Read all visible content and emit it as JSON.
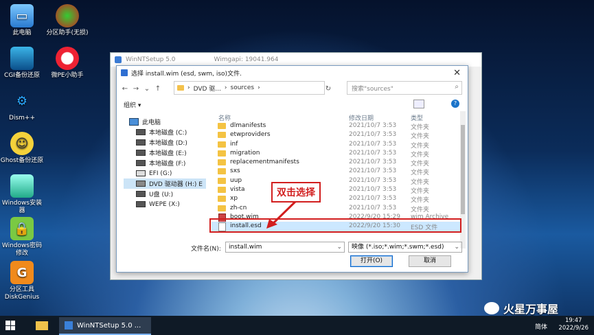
{
  "desktop_icons": [
    {
      "label": "此电脑",
      "icon": "computer-icon"
    },
    {
      "label": "分区助手(无损)",
      "icon": "partition-assistant-icon"
    },
    {
      "label": "CGI备份还原",
      "icon": "cgi-backup-icon"
    },
    {
      "label": "微PE小助手",
      "icon": "pe-helper-icon"
    },
    {
      "label": "Dism++",
      "icon": "dism-icon"
    },
    {
      "label": "Ghost备份还原",
      "icon": "ghost-icon"
    },
    {
      "label": "Windows安装器",
      "icon": "windows-installer-icon"
    },
    {
      "label": "Windows密码修改",
      "icon": "password-lock-icon"
    },
    {
      "label": "分区工具DiskGenius",
      "icon": "diskgenius-icon"
    }
  ],
  "bg_window": {
    "title": "WinNTSetup 5.0",
    "wimgapi": "Wimgapi: 19041.964"
  },
  "dialog": {
    "title": "选择 install.wim (esd, swm, iso)文件.",
    "path": [
      "DVD 驱...",
      "sources"
    ],
    "search_placeholder": "搜索\"sources\"",
    "organize": "组织 ▾",
    "nav": [
      {
        "label": "此电脑",
        "sel": false
      },
      {
        "label": "本地磁盘 (C:)",
        "sel": false
      },
      {
        "label": "本地磁盘 (D:)",
        "sel": false
      },
      {
        "label": "本地磁盘 (E:)",
        "sel": false
      },
      {
        "label": "本地磁盘 (F:)",
        "sel": false
      },
      {
        "label": "EFI (G:)",
        "sel": false
      },
      {
        "label": "DVD 驱动器 (H:) E",
        "sel": true
      },
      {
        "label": "U盘 (U:)",
        "sel": false
      },
      {
        "label": "WEPE (X:)",
        "sel": false
      }
    ],
    "columns": {
      "name": "名称",
      "date": "修改日期",
      "type": "类型"
    },
    "files": [
      {
        "name": "dlmanifests",
        "date": "2021/10/7 3:53",
        "type": "文件夹",
        "kind": "folder"
      },
      {
        "name": "etwproviders",
        "date": "2021/10/7 3:53",
        "type": "文件夹",
        "kind": "folder"
      },
      {
        "name": "inf",
        "date": "2021/10/7 3:53",
        "type": "文件夹",
        "kind": "folder"
      },
      {
        "name": "migration",
        "date": "2021/10/7 3:53",
        "type": "文件夹",
        "kind": "folder"
      },
      {
        "name": "replacementmanifests",
        "date": "2021/10/7 3:53",
        "type": "文件夹",
        "kind": "folder"
      },
      {
        "name": "sxs",
        "date": "2021/10/7 3:53",
        "type": "文件夹",
        "kind": "folder"
      },
      {
        "name": "uup",
        "date": "2021/10/7 3:53",
        "type": "文件夹",
        "kind": "folder"
      },
      {
        "name": "vista",
        "date": "2021/10/7 3:53",
        "type": "文件夹",
        "kind": "folder"
      },
      {
        "name": "xp",
        "date": "2021/10/7 3:53",
        "type": "文件夹",
        "kind": "folder"
      },
      {
        "name": "zh-cn",
        "date": "2021/10/7 3:53",
        "type": "文件夹",
        "kind": "folder"
      },
      {
        "name": "boot.wim",
        "date": "2022/9/20 15:29",
        "type": "wim Archive",
        "kind": "wim"
      },
      {
        "name": "install.esd",
        "date": "2022/9/20 15:30",
        "type": "ESD 文件",
        "kind": "doc"
      }
    ],
    "filename_label": "文件名(N):",
    "filename_value": "install.wim",
    "filetype_value": "映像 (*.iso;*.wim;*.swm;*.esd)",
    "open_button": "打开(O)",
    "cancel_button": "取消"
  },
  "annotation": "双击选择",
  "taskbar": {
    "app": "WinNTSetup 5.0 ...",
    "lang": "简体",
    "time": "19:47",
    "date": "2022/9/26"
  },
  "watermark": "火星万事屋"
}
